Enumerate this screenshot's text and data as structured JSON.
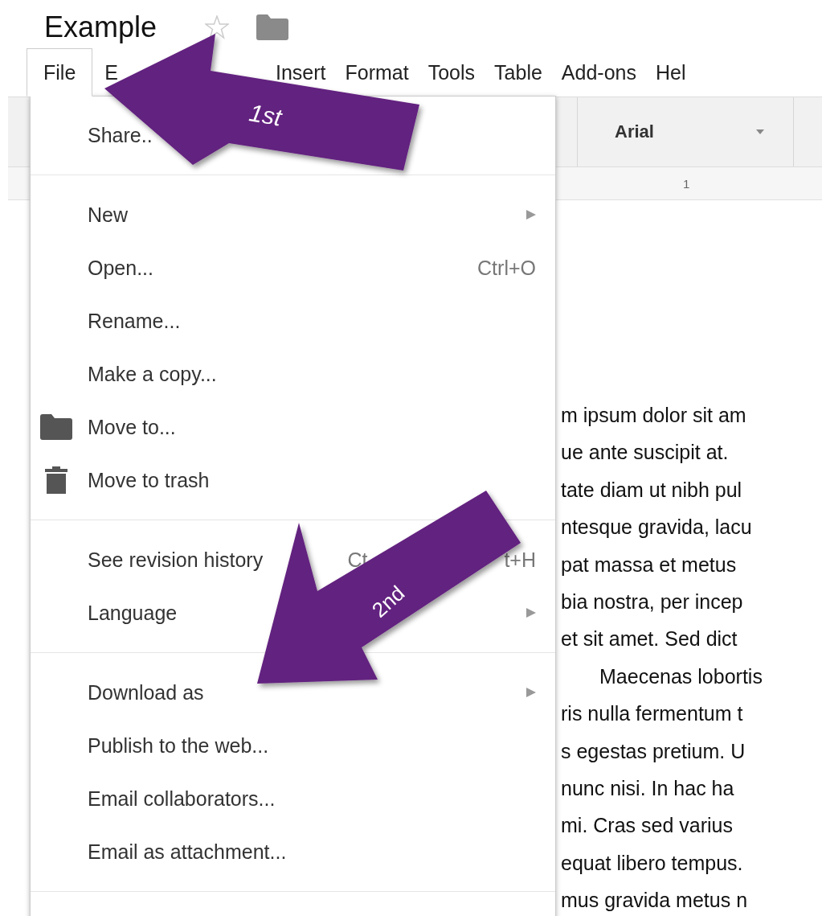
{
  "document_title": "Example",
  "starred": false,
  "menu_bar": [
    {
      "label": "File",
      "selected": true
    },
    {
      "label": "E",
      "selected": false
    },
    {
      "label": "Insert",
      "selected": false
    },
    {
      "label": "Format",
      "selected": false
    },
    {
      "label": "Tools",
      "selected": false
    },
    {
      "label": "Table",
      "selected": false
    },
    {
      "label": "Add-ons",
      "selected": false
    },
    {
      "label": "Hel",
      "selected": false
    }
  ],
  "toolbar": {
    "font": "Arial"
  },
  "ruler": {
    "mark": "1"
  },
  "file_menu": [
    {
      "kind": "plain",
      "label": "Share..",
      "submenu": false
    },
    {
      "kind": "separator"
    },
    {
      "kind": "plain",
      "label": "New",
      "submenu": true
    },
    {
      "kind": "plain",
      "label": "Open...",
      "shortcut": "Ctrl+O",
      "submenu": false
    },
    {
      "kind": "plain",
      "label": "Rename...",
      "submenu": false
    },
    {
      "kind": "plain",
      "label": "Make a copy...",
      "submenu": false
    },
    {
      "kind": "folder",
      "label": "Move to...",
      "submenu": false
    },
    {
      "kind": "trash",
      "label": "Move to trash",
      "submenu": false
    },
    {
      "kind": "separator"
    },
    {
      "kind": "plain",
      "label": "See revision history",
      "shortcut": "Ct",
      "shortcut_end": "t+H",
      "submenu": false
    },
    {
      "kind": "plain",
      "label": "Language",
      "submenu": true
    },
    {
      "kind": "separator"
    },
    {
      "kind": "plain",
      "label": "Download as",
      "submenu": true
    },
    {
      "kind": "plain",
      "label": "Publish to the web...",
      "submenu": false
    },
    {
      "kind": "plain",
      "label": "Email collaborators...",
      "submenu": false
    },
    {
      "kind": "plain",
      "label": "Email as attachment...",
      "submenu": false
    },
    {
      "kind": "separator"
    }
  ],
  "document_lines": [
    {
      "text": "m ipsum dolor sit am",
      "indented": false
    },
    {
      "text": "ue ante suscipit at.",
      "indented": false
    },
    {
      "text": "tate diam ut nibh pul",
      "indented": false
    },
    {
      "text": "ntesque gravida, lacu",
      "indented": false
    },
    {
      "text": "pat massa et metus",
      "indented": false
    },
    {
      "text": "bia nostra, per incep",
      "indented": false
    },
    {
      "text": "et sit amet. Sed dict",
      "indented": false
    },
    {
      "text": "Maecenas lobortis",
      "indented": true
    },
    {
      "text": "ris nulla fermentum t",
      "indented": false
    },
    {
      "text": "s egestas pretium. U",
      "indented": false
    },
    {
      "text": "nunc nisi. In hac ha",
      "indented": false
    },
    {
      "text": "mi. Cras sed varius",
      "indented": false
    },
    {
      "text": "equat libero tempus.",
      "indented": false
    },
    {
      "text": "mus gravida metus n",
      "indented": false
    }
  ],
  "annotations": [
    {
      "label": "1st"
    },
    {
      "label": "2nd"
    }
  ]
}
